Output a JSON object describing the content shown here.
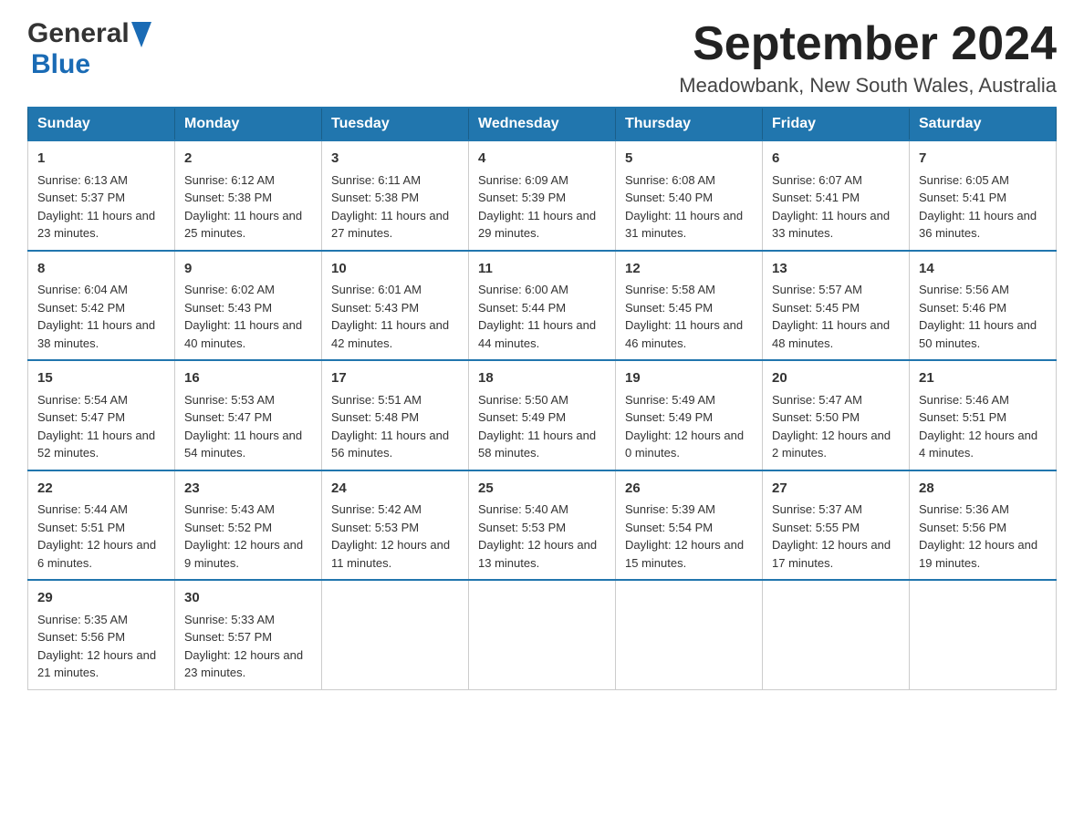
{
  "logo": {
    "general": "General",
    "blue": "Blue"
  },
  "title": "September 2024",
  "location": "Meadowbank, New South Wales, Australia",
  "days_of_week": [
    "Sunday",
    "Monday",
    "Tuesday",
    "Wednesday",
    "Thursday",
    "Friday",
    "Saturday"
  ],
  "weeks": [
    [
      {
        "day": "1",
        "sunrise": "6:13 AM",
        "sunset": "5:37 PM",
        "daylight": "11 hours and 23 minutes."
      },
      {
        "day": "2",
        "sunrise": "6:12 AM",
        "sunset": "5:38 PM",
        "daylight": "11 hours and 25 minutes."
      },
      {
        "day": "3",
        "sunrise": "6:11 AM",
        "sunset": "5:38 PM",
        "daylight": "11 hours and 27 minutes."
      },
      {
        "day": "4",
        "sunrise": "6:09 AM",
        "sunset": "5:39 PM",
        "daylight": "11 hours and 29 minutes."
      },
      {
        "day": "5",
        "sunrise": "6:08 AM",
        "sunset": "5:40 PM",
        "daylight": "11 hours and 31 minutes."
      },
      {
        "day": "6",
        "sunrise": "6:07 AM",
        "sunset": "5:41 PM",
        "daylight": "11 hours and 33 minutes."
      },
      {
        "day": "7",
        "sunrise": "6:05 AM",
        "sunset": "5:41 PM",
        "daylight": "11 hours and 36 minutes."
      }
    ],
    [
      {
        "day": "8",
        "sunrise": "6:04 AM",
        "sunset": "5:42 PM",
        "daylight": "11 hours and 38 minutes."
      },
      {
        "day": "9",
        "sunrise": "6:02 AM",
        "sunset": "5:43 PM",
        "daylight": "11 hours and 40 minutes."
      },
      {
        "day": "10",
        "sunrise": "6:01 AM",
        "sunset": "5:43 PM",
        "daylight": "11 hours and 42 minutes."
      },
      {
        "day": "11",
        "sunrise": "6:00 AM",
        "sunset": "5:44 PM",
        "daylight": "11 hours and 44 minutes."
      },
      {
        "day": "12",
        "sunrise": "5:58 AM",
        "sunset": "5:45 PM",
        "daylight": "11 hours and 46 minutes."
      },
      {
        "day": "13",
        "sunrise": "5:57 AM",
        "sunset": "5:45 PM",
        "daylight": "11 hours and 48 minutes."
      },
      {
        "day": "14",
        "sunrise": "5:56 AM",
        "sunset": "5:46 PM",
        "daylight": "11 hours and 50 minutes."
      }
    ],
    [
      {
        "day": "15",
        "sunrise": "5:54 AM",
        "sunset": "5:47 PM",
        "daylight": "11 hours and 52 minutes."
      },
      {
        "day": "16",
        "sunrise": "5:53 AM",
        "sunset": "5:47 PM",
        "daylight": "11 hours and 54 minutes."
      },
      {
        "day": "17",
        "sunrise": "5:51 AM",
        "sunset": "5:48 PM",
        "daylight": "11 hours and 56 minutes."
      },
      {
        "day": "18",
        "sunrise": "5:50 AM",
        "sunset": "5:49 PM",
        "daylight": "11 hours and 58 minutes."
      },
      {
        "day": "19",
        "sunrise": "5:49 AM",
        "sunset": "5:49 PM",
        "daylight": "12 hours and 0 minutes."
      },
      {
        "day": "20",
        "sunrise": "5:47 AM",
        "sunset": "5:50 PM",
        "daylight": "12 hours and 2 minutes."
      },
      {
        "day": "21",
        "sunrise": "5:46 AM",
        "sunset": "5:51 PM",
        "daylight": "12 hours and 4 minutes."
      }
    ],
    [
      {
        "day": "22",
        "sunrise": "5:44 AM",
        "sunset": "5:51 PM",
        "daylight": "12 hours and 6 minutes."
      },
      {
        "day": "23",
        "sunrise": "5:43 AM",
        "sunset": "5:52 PM",
        "daylight": "12 hours and 9 minutes."
      },
      {
        "day": "24",
        "sunrise": "5:42 AM",
        "sunset": "5:53 PM",
        "daylight": "12 hours and 11 minutes."
      },
      {
        "day": "25",
        "sunrise": "5:40 AM",
        "sunset": "5:53 PM",
        "daylight": "12 hours and 13 minutes."
      },
      {
        "day": "26",
        "sunrise": "5:39 AM",
        "sunset": "5:54 PM",
        "daylight": "12 hours and 15 minutes."
      },
      {
        "day": "27",
        "sunrise": "5:37 AM",
        "sunset": "5:55 PM",
        "daylight": "12 hours and 17 minutes."
      },
      {
        "day": "28",
        "sunrise": "5:36 AM",
        "sunset": "5:56 PM",
        "daylight": "12 hours and 19 minutes."
      }
    ],
    [
      {
        "day": "29",
        "sunrise": "5:35 AM",
        "sunset": "5:56 PM",
        "daylight": "12 hours and 21 minutes."
      },
      {
        "day": "30",
        "sunrise": "5:33 AM",
        "sunset": "5:57 PM",
        "daylight": "12 hours and 23 minutes."
      },
      null,
      null,
      null,
      null,
      null
    ]
  ],
  "labels": {
    "sunrise": "Sunrise:",
    "sunset": "Sunset:",
    "daylight": "Daylight:"
  }
}
